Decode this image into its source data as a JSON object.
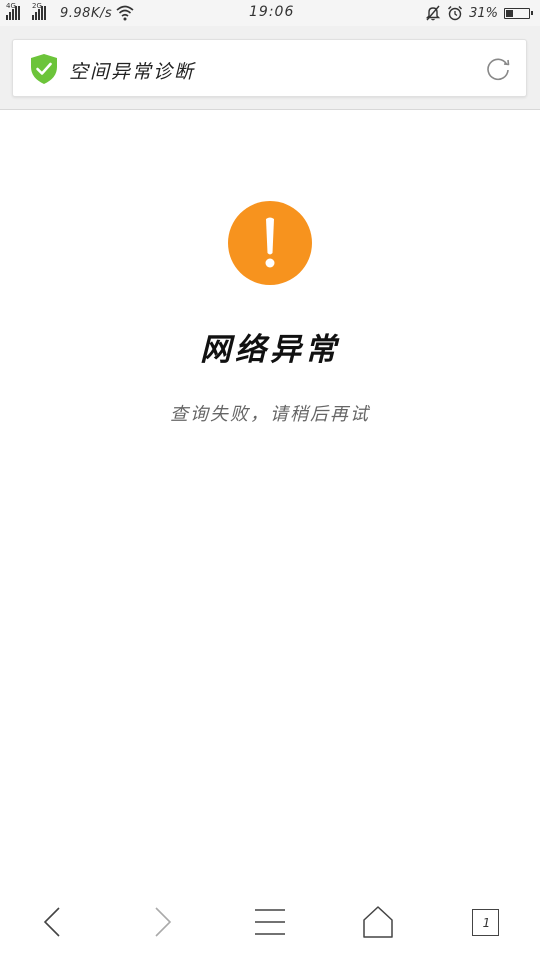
{
  "status_bar": {
    "net1": "4G",
    "net2": "2G",
    "speed": "9.98K/s",
    "time": "19:06",
    "battery_pct": "31%",
    "battery_level": 0.31
  },
  "header": {
    "title": "空间异常诊断",
    "shield_icon": "shield-check-icon",
    "refresh_icon": "refresh-icon",
    "shield_color": "#6cc43a"
  },
  "main": {
    "icon": "exclamation-icon",
    "icon_color": "#f7931e",
    "error_title": "网络异常",
    "error_message": "查询失败，请稍后再试"
  },
  "bottom_nav": {
    "back_icon": "back-arrow-icon",
    "forward_icon": "forward-arrow-icon",
    "menu_icon": "menu-icon",
    "home_icon": "home-icon",
    "tabs_icon": "tabs-icon",
    "tab_count": "1"
  }
}
